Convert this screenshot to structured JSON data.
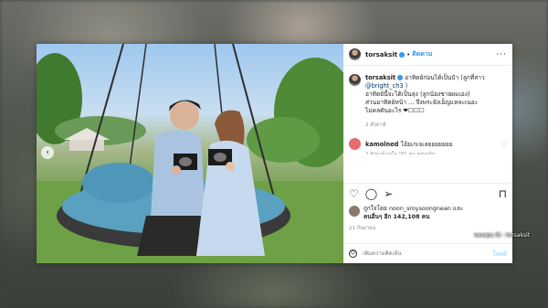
{
  "post": {
    "username": "torsaksit",
    "follow_label": "ติดตาม",
    "caption_lines": [
      "อาทิตย์ก่อนได้เป็นป๋า (ลูกที่สาว",
      "@bright_ch3 )",
      "อาทิตย์นี้จะได้เป็นลุง (ลูกน้องชายผมเอง)",
      "ส่วนอาทิตย์หน้า ... จึงพระยังเอ็ญแหละเนอะ",
      "ไม่คลดันอะไร ❤☐☐☐"
    ],
    "caption_date": "2 สัปดาห์",
    "comment": {
      "username": "kamolned",
      "text": "โอ้ยเกเจเลยยยยยยย",
      "meta": "2 สัปดาห์   ถูกใจ 161 คน   ตอบกลับ"
    },
    "likes_line1": "ถูกใจโดย noon_sroysoongnean และ",
    "likes_line2": "คนอื่นๆ อีก 142,108 คน",
    "post_date": "21 กันยายน",
    "comment_placeholder": "เพิ่มความคิดเห็น",
    "post_button": "โพสต์"
  },
  "credit": "ขอบคุณ IG : torsaksit",
  "icons": {
    "more": "more-icon",
    "like": "heart-icon",
    "comment": "comment-icon",
    "share": "share-icon",
    "save": "bookmark-icon",
    "emoji": "emoji-icon"
  },
  "colors": {
    "verified": "#3897f0",
    "follow": "#3897f0",
    "comment_avatar": "#e76e6e"
  }
}
